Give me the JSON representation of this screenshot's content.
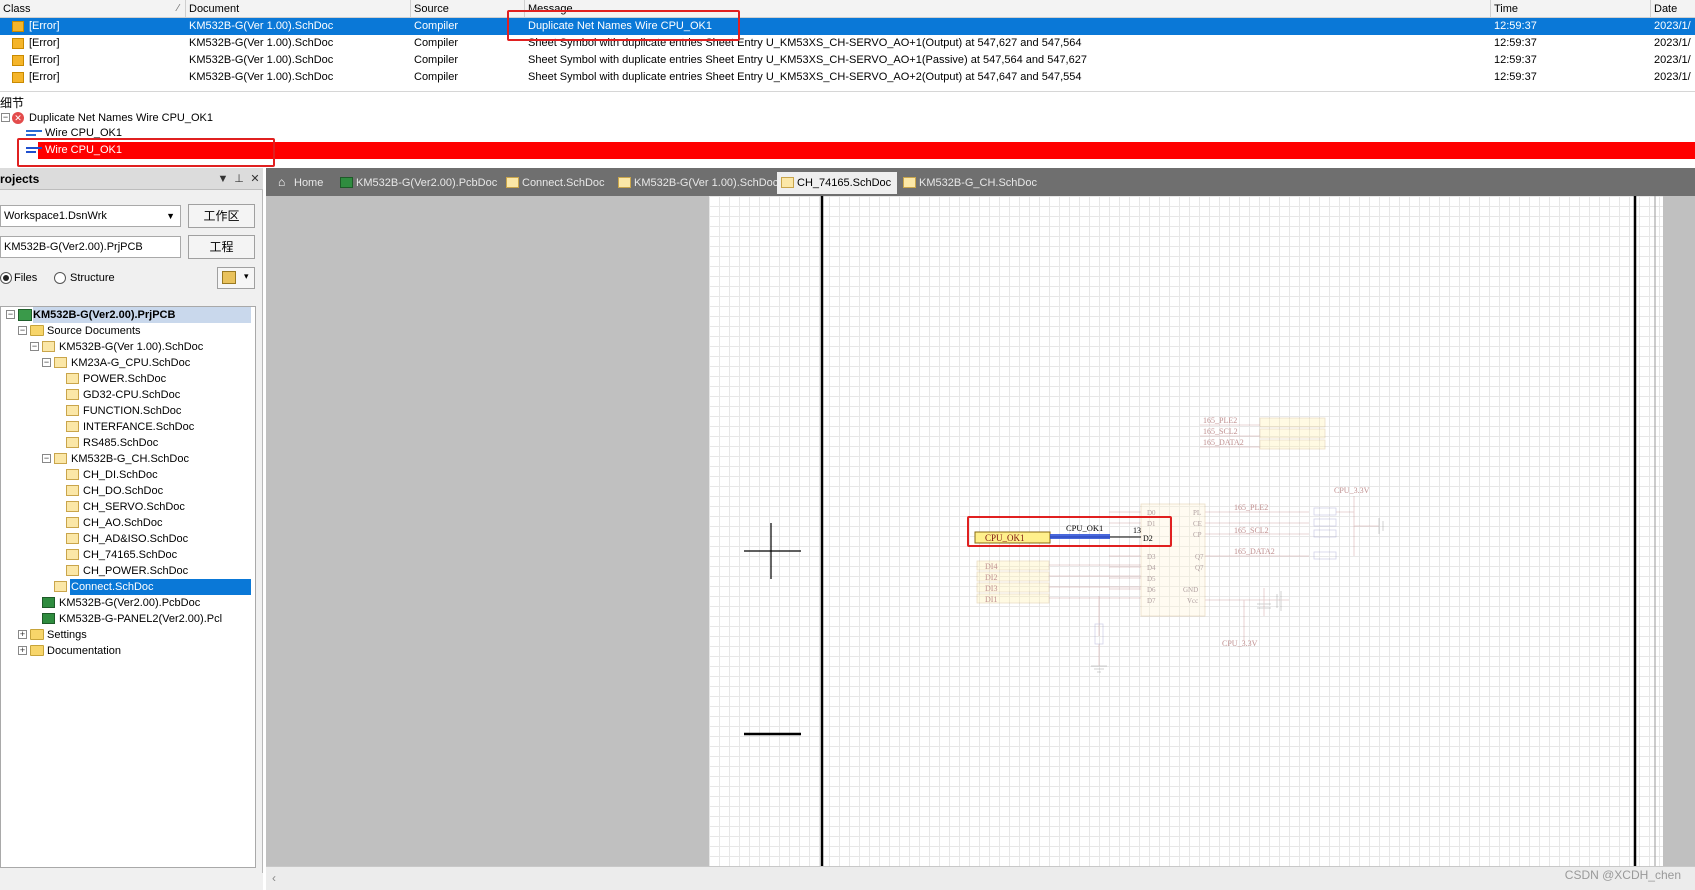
{
  "messages": {
    "columns": [
      "Class",
      "Document",
      "Source",
      "Message",
      "Time",
      "Date"
    ],
    "rows": [
      {
        "class": "[Error]",
        "document": "KM532B-G(Ver 1.00).SchDoc",
        "source": "Compiler",
        "message": "Duplicate Net Names Wire CPU_OK1",
        "time": "12:59:37",
        "date": "2023/1/"
      },
      {
        "class": "[Error]",
        "document": "KM532B-G(Ver 1.00).SchDoc",
        "source": "Compiler",
        "message": "Sheet Symbol with duplicate entries Sheet Entry U_KM53XS_CH-SERVO_AO+1(Output) at 547,627 and 547,564",
        "time": "12:59:37",
        "date": "2023/1/"
      },
      {
        "class": "[Error]",
        "document": "KM532B-G(Ver 1.00).SchDoc",
        "source": "Compiler",
        "message": "Sheet Symbol with duplicate entries Sheet Entry U_KM53XS_CH-SERVO_AO+1(Passive) at 547,564 and 547,627",
        "time": "12:59:37",
        "date": "2023/1/"
      },
      {
        "class": "[Error]",
        "document": "KM532B-G(Ver 1.00).SchDoc",
        "source": "Compiler",
        "message": "Sheet Symbol with duplicate entries Sheet Entry U_KM53XS_CH-SERVO_AO+2(Output) at 547,647 and 547,554",
        "time": "12:59:37",
        "date": "2023/1/"
      }
    ],
    "selected_index": 0
  },
  "details": {
    "title": "细节",
    "root_item": "Duplicate Net Names Wire CPU_OK1",
    "children": [
      "Wire CPU_OK1",
      "Wire CPU_OK1"
    ]
  },
  "projects": {
    "title": "rojects",
    "workspace": "Workspace1.DsnWrk",
    "workspace_button": "工作区",
    "project": "KM532B-G(Ver2.00).PrjPCB",
    "project_button": "工程",
    "radio_files": "Files",
    "radio_structure": "Structure",
    "tree": [
      {
        "label": "KM532B-G(Ver2.00).PrjPCB",
        "kind": "project"
      },
      {
        "label": "Source Documents",
        "kind": "folder"
      },
      {
        "label": "KM532B-G(Ver 1.00).SchDoc",
        "kind": "sch"
      },
      {
        "label": "KM23A-G_CPU.SchDoc",
        "kind": "sch"
      },
      {
        "label": "POWER.SchDoc",
        "kind": "sch"
      },
      {
        "label": "GD32-CPU.SchDoc",
        "kind": "sch"
      },
      {
        "label": "FUNCTION.SchDoc",
        "kind": "sch"
      },
      {
        "label": "INTERFANCE.SchDoc",
        "kind": "sch"
      },
      {
        "label": "RS485.SchDoc",
        "kind": "sch"
      },
      {
        "label": "KM532B-G_CH.SchDoc",
        "kind": "sch"
      },
      {
        "label": "CH_DI.SchDoc",
        "kind": "sch"
      },
      {
        "label": "CH_DO.SchDoc",
        "kind": "sch"
      },
      {
        "label": "CH_SERVO.SchDoc",
        "kind": "sch"
      },
      {
        "label": "CH_AO.SchDoc",
        "kind": "sch"
      },
      {
        "label": "CH_AD&ISO.SchDoc",
        "kind": "sch"
      },
      {
        "label": "CH_74165.SchDoc",
        "kind": "sch"
      },
      {
        "label": "CH_POWER.SchDoc",
        "kind": "sch"
      },
      {
        "label": "Connect.SchDoc",
        "kind": "sch"
      },
      {
        "label": "KM532B-G(Ver2.00).PcbDoc",
        "kind": "pcb"
      },
      {
        "label": "KM532B-G-PANEL2(Ver2.00).Pcl",
        "kind": "pcb"
      },
      {
        "label": "Settings",
        "kind": "folder"
      },
      {
        "label": "Documentation",
        "kind": "folder"
      }
    ]
  },
  "tabs": [
    "Home",
    "KM532B-G(Ver2.00).PcbDoc",
    "Connect.SchDoc",
    "KM532B-G(Ver 1.00).SchDoc",
    "CH_74165.SchDoc",
    "KM532B-G_CH.SchDoc"
  ],
  "active_tab_index": 4,
  "schematic": {
    "net_port": "CPU_OK1",
    "wire_label": "CPU_OK1",
    "pin_number": "13",
    "pin_name": "D2",
    "faded_ports_top": [
      "165_PLE2",
      "165_SCL2",
      "165_DATA2"
    ],
    "faded_ports_right": [
      "165_PLE2",
      "165_SCL2",
      "165_DATA2"
    ],
    "faded_inputs": [
      "DI4",
      "DI2",
      "DI3",
      "DI1"
    ],
    "power_label_top": "CPU_3.3V",
    "power_label_bottom": "CPU_3.3V",
    "chip_pins_left": [
      "D0",
      "D1",
      "D2",
      "D3",
      "D4",
      "D5",
      "D6",
      "D7"
    ],
    "chip_pins_right": [
      "PL",
      "CE",
      "CP",
      "Q7",
      "Q7",
      "GND",
      "Vcc"
    ]
  },
  "watermark": "CSDN @XCDH_chen",
  "colors": {
    "selection": "#0a78d7",
    "highlight_red": "#ff0000",
    "annotation": "#e02020",
    "port_fill": "#fff08c",
    "wire_blue": "#2a4fd6"
  }
}
